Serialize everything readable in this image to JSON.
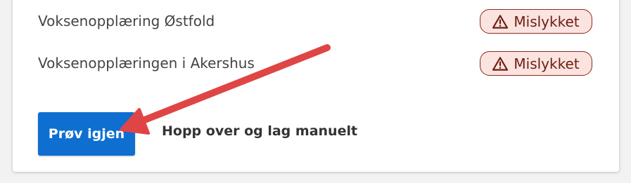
{
  "organizations": [
    {
      "name": "Voksenopplæring Østfold",
      "status": "Mislykket"
    },
    {
      "name": "Voksenopplæringen i Akershus",
      "status": "Mislykket"
    }
  ],
  "actions": {
    "retry_label": "Prøv igjen",
    "skip_label": "Hopp over og lag manuelt"
  },
  "icons": {
    "status": "warning-triangle-icon",
    "annotation": "red-arrow"
  },
  "colors": {
    "primary": "#0f6fd1",
    "error_bg": "#fbe3e0",
    "error_border": "#8a2a1e",
    "error_text": "#6d1d12",
    "annotation": "#e04545"
  }
}
